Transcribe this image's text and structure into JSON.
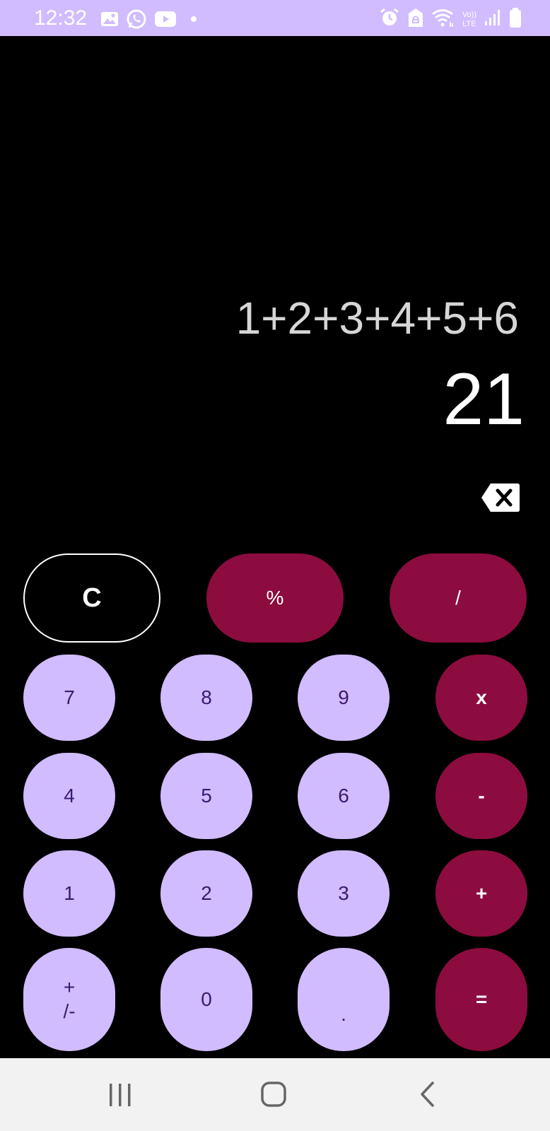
{
  "status_bar": {
    "time": "12:32",
    "left_icons": [
      "gallery-icon",
      "whatsapp-icon",
      "youtube-icon",
      "dot-icon"
    ],
    "right_icons": [
      "alarm-icon",
      "vpn-icon",
      "wifi-icon",
      "volte-icon",
      "signal-icon",
      "battery-icon"
    ],
    "volte_label_top": "Vo))",
    "volte_label_bottom": "LTE",
    "background": "#d0bcff"
  },
  "display": {
    "expression": "1+2+3+4+5+6",
    "result": "21"
  },
  "keypad": {
    "top_row": [
      {
        "label": "C",
        "role": "clear"
      },
      {
        "label": "%",
        "role": "operator"
      },
      {
        "label": "/",
        "role": "operator"
      }
    ],
    "rows": [
      [
        {
          "label": "7",
          "role": "digit"
        },
        {
          "label": "8",
          "role": "digit"
        },
        {
          "label": "9",
          "role": "digit"
        },
        {
          "label": "x",
          "role": "operator"
        }
      ],
      [
        {
          "label": "4",
          "role": "digit"
        },
        {
          "label": "5",
          "role": "digit"
        },
        {
          "label": "6",
          "role": "digit"
        },
        {
          "label": "-",
          "role": "operator"
        }
      ],
      [
        {
          "label": "1",
          "role": "digit"
        },
        {
          "label": "2",
          "role": "digit"
        },
        {
          "label": "3",
          "role": "digit"
        },
        {
          "label": "+",
          "role": "operator"
        }
      ],
      [
        {
          "label_top": "+",
          "label_bottom": "/-",
          "role": "sign"
        },
        {
          "label": "0",
          "role": "digit"
        },
        {
          "label": ".",
          "role": "digit"
        },
        {
          "label": "=",
          "role": "operator"
        }
      ]
    ]
  },
  "colors": {
    "digit_bg": "#d0bcff",
    "digit_text": "#3b1a70",
    "operator_bg": "#8c0c3f",
    "operator_text": "#ffffff",
    "background": "#000000"
  },
  "nav_bar": {
    "items": [
      "recent-apps-icon",
      "home-icon",
      "back-icon"
    ]
  }
}
